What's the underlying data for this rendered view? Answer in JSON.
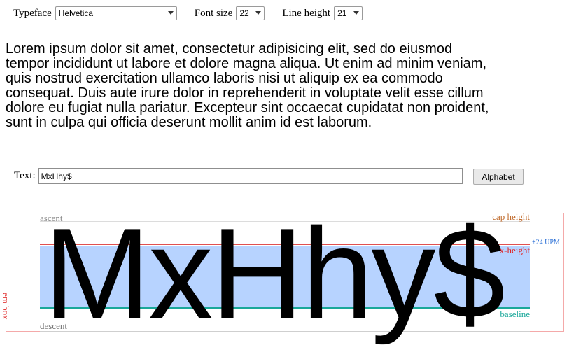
{
  "controls": {
    "typeface_label": "Typeface",
    "typeface_value": "Helvetica",
    "font_size_label": "Font size",
    "font_size_value": "22",
    "line_height_label": "Line height",
    "line_height_value": "21"
  },
  "paragraph": "Lorem ipsum dolor sit amet, consectetur adipisicing elit, sed do eiusmod tempor incididunt ut labore et dolore magna aliqua. Ut enim ad minim veniam, quis nostrud exercitation ullamco laboris nisi ut aliquip ex ea commodo consequat. Duis aute irure dolor in reprehenderit in voluptate velit esse cillum dolore eu fugiat nulla pariatur. Excepteur sint occaecat cupidatat non proident, sunt in culpa qui officia deserunt mollit anim id est laborum.",
  "text_field": {
    "label": "Text:",
    "value": "MxHhy$"
  },
  "alphabet_button": "Alphabet",
  "metrics": {
    "sample_text": "MxHhy$",
    "ascent": "ascent",
    "cap_height": "cap height",
    "upm_delta": "+24 UPM",
    "x_height": "x-height",
    "baseline": "baseline",
    "descent": "descent",
    "em_box": "em box"
  },
  "colors": {
    "x_height_band": "#b7d3ff",
    "cap_height": "#c06a2b",
    "x_height": "#e02020",
    "baseline": "#1aa89a",
    "em_box": "#e23a3a",
    "upm": "#2a6fd6"
  }
}
